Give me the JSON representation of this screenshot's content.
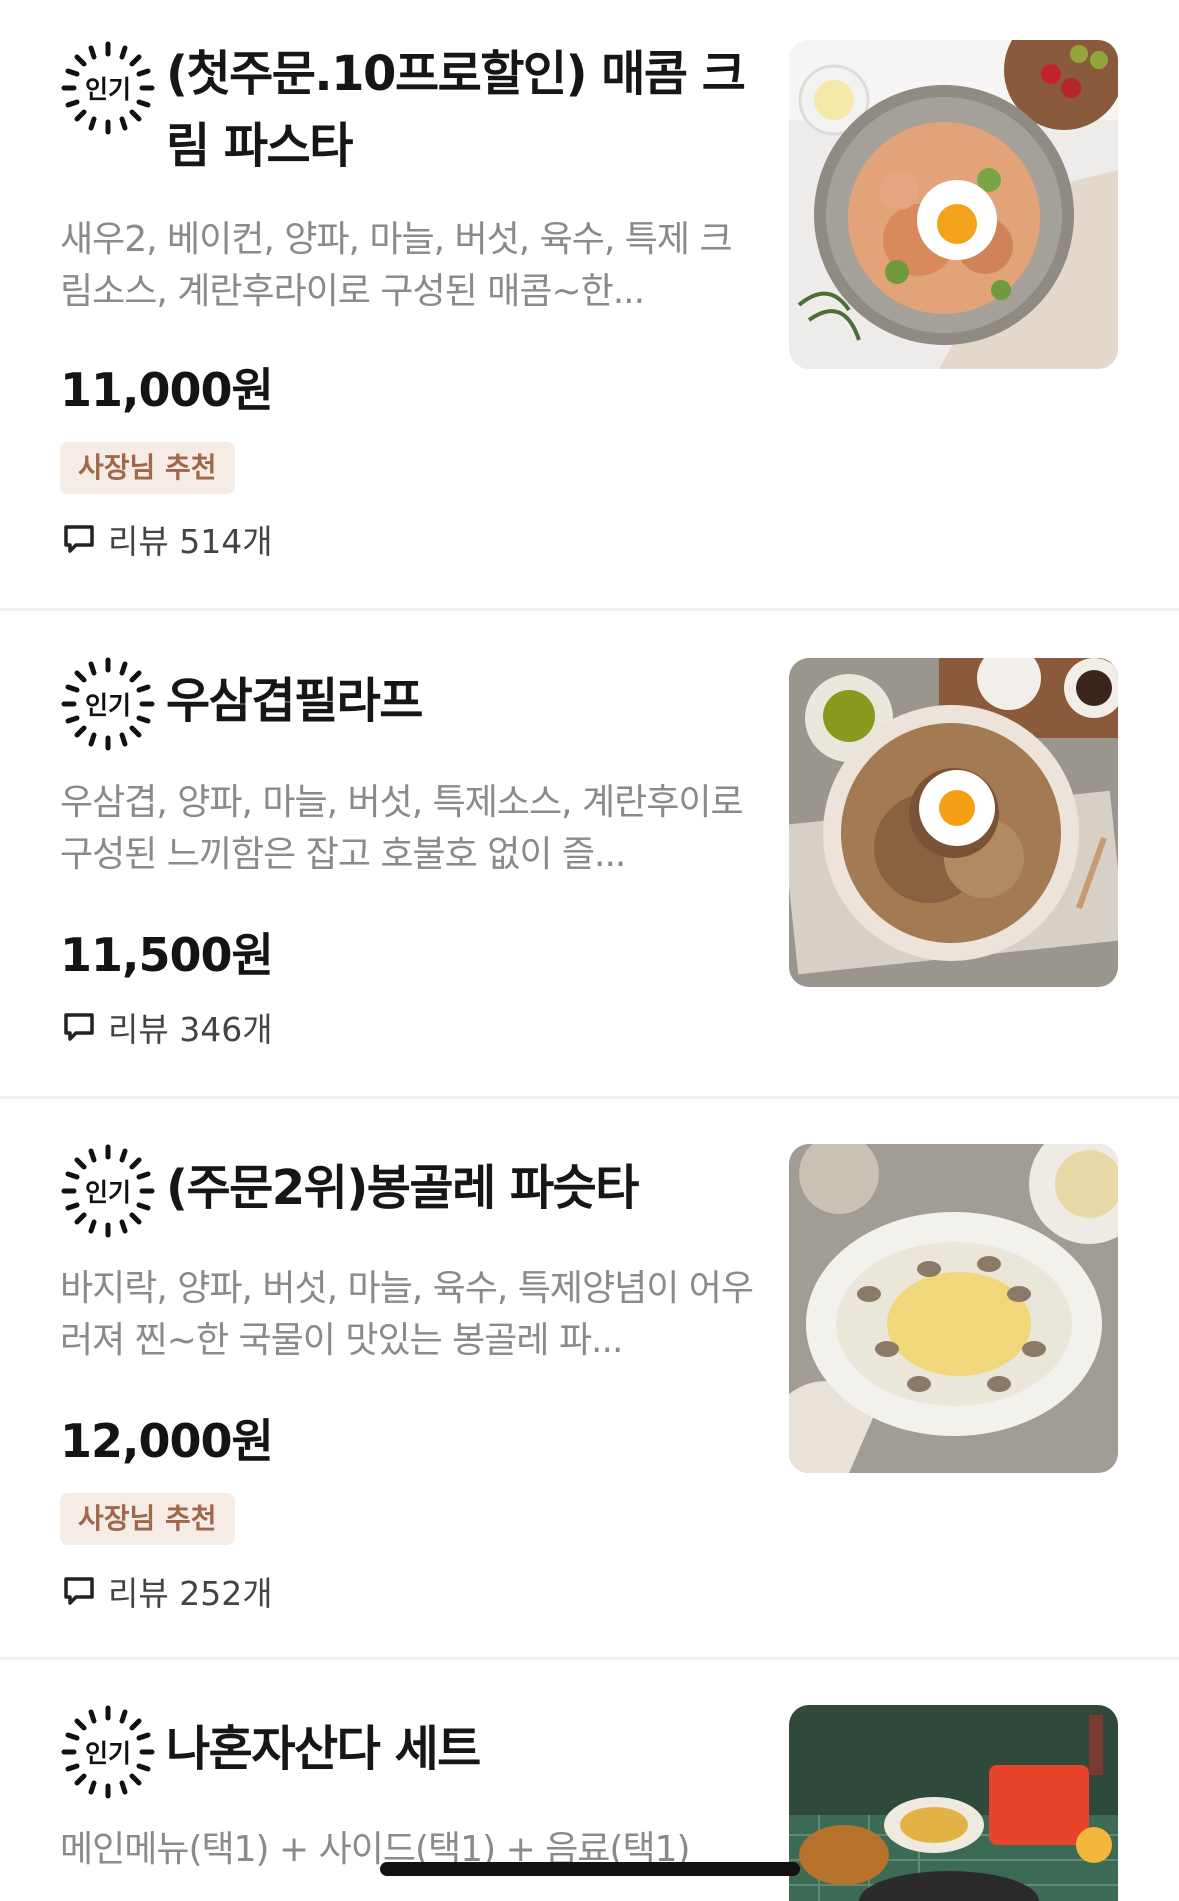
{
  "badge_label": "인기",
  "review_prefix": "리뷰",
  "items": [
    {
      "title": "(첫주문.10프로할인) 매콤 크림 파스타",
      "description": "새우2, 베이컨, 양파, 마늘, 버섯, 육수, 특제 크림소스, 계란후라이로 구성된 매콤~한...",
      "price": "11,000원",
      "tag": "사장님 추천",
      "review": "리뷰 514개"
    },
    {
      "title": "우삼겹필라프",
      "description": "우삼겹, 양파, 마늘, 버섯, 특제소스, 계란후이로 구성된 느끼함은 잡고 호불호 없이 즐...",
      "price": "11,500원",
      "tag": "",
      "review": "리뷰 346개"
    },
    {
      "title": "(주문2위)봉골레 파슷타",
      "description": "바지락, 양파, 버섯, 마늘, 육수, 특제양념이 어우러져 찐~한 국물이 맛있는 봉골레 파...",
      "price": "12,000원",
      "tag": "사장님 추천",
      "review": "리뷰 252개"
    },
    {
      "title": "나혼자산다 세트",
      "description": "메인메뉴(택1) + 사이드(택1) + 음료(택1)",
      "price": "",
      "tag": "",
      "review": ""
    }
  ],
  "colors": {
    "tag_bg": "#f5ece6",
    "tag_text": "#a1674a",
    "desc_text": "#8a8a8a",
    "divider": "#f0f0f0"
  },
  "icons": {
    "badge": "popular-badge-icon",
    "review": "speech-bubble-icon"
  }
}
